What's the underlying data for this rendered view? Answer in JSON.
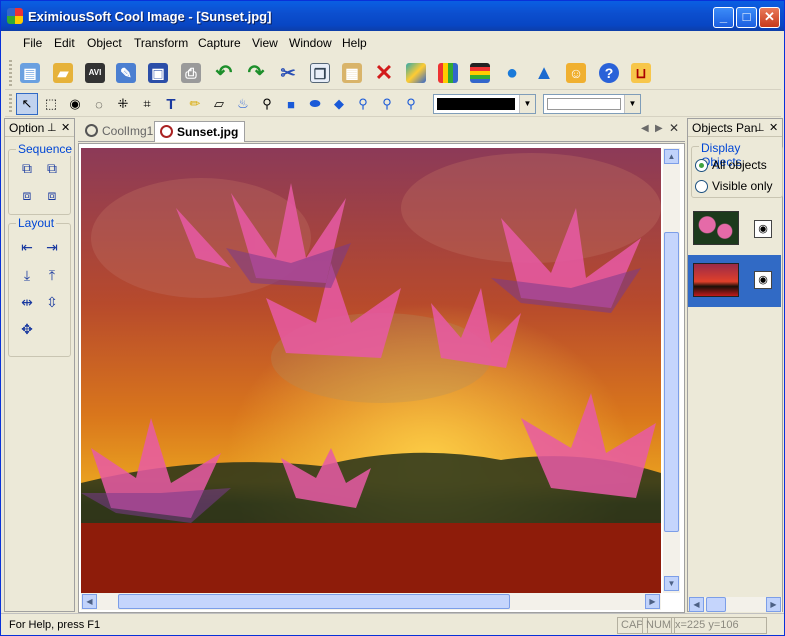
{
  "window": {
    "title": "EximiousSoft Cool Image - [Sunset.jpg]"
  },
  "menu": [
    "File",
    "Edit",
    "Object",
    "Transform",
    "Capture",
    "View",
    "Window",
    "Help"
  ],
  "toolbar1": {
    "icons": [
      "new-icon",
      "open-icon",
      "avi-icon",
      "edit-icon",
      "save-icon",
      "print-icon",
      "undo-icon",
      "redo-icon",
      "cut-icon",
      "copy-icon",
      "paste-icon",
      "delete-icon",
      "adjust-icon",
      "histogram-icon",
      "levels-icon",
      "drop-icon",
      "sharpen-icon",
      "user-icon",
      "help-icon",
      "cart-icon"
    ],
    "avi_label": "AVI"
  },
  "toolbar2": {
    "icons": [
      "pointer-icon",
      "rect-select-icon",
      "ellipse-select-icon",
      "lasso-icon",
      "magic-wand-icon",
      "crop-icon",
      "text-icon",
      "pencil-icon",
      "eraser-icon",
      "fill-icon",
      "eyedropper-icon",
      "rectangle-icon",
      "ellipse-icon",
      "polygon-icon",
      "zoom-in-icon",
      "zoom-out-icon",
      "zoom-reset-icon"
    ],
    "text_glyph": "T",
    "color1": "#000000",
    "color2": "#ffffff"
  },
  "left_panel": {
    "title": "Option",
    "sequence": {
      "label": "Sequence"
    },
    "layout": {
      "label": "Layout"
    }
  },
  "tabs": [
    {
      "label": "CoolImg1",
      "active": false
    },
    {
      "label": "Sunset.jpg",
      "active": true
    }
  ],
  "objects_panel": {
    "title": "Objects Pan",
    "display_label": "Display Objects",
    "options": [
      {
        "label": "All objects",
        "selected": true
      },
      {
        "label": "Visible only",
        "selected": false
      }
    ],
    "objects": [
      {
        "name": "lotus-thumbnail"
      },
      {
        "name": "sunset-thumbnail",
        "selected": true
      }
    ]
  },
  "status": {
    "help": "For Help, press F1",
    "cap": "CAP",
    "num": "NUM",
    "coords": "x=225 y=106"
  },
  "colors": {
    "accent": "#0a5fe3",
    "selection": "#316ac5",
    "panel": "#ece9d8"
  }
}
